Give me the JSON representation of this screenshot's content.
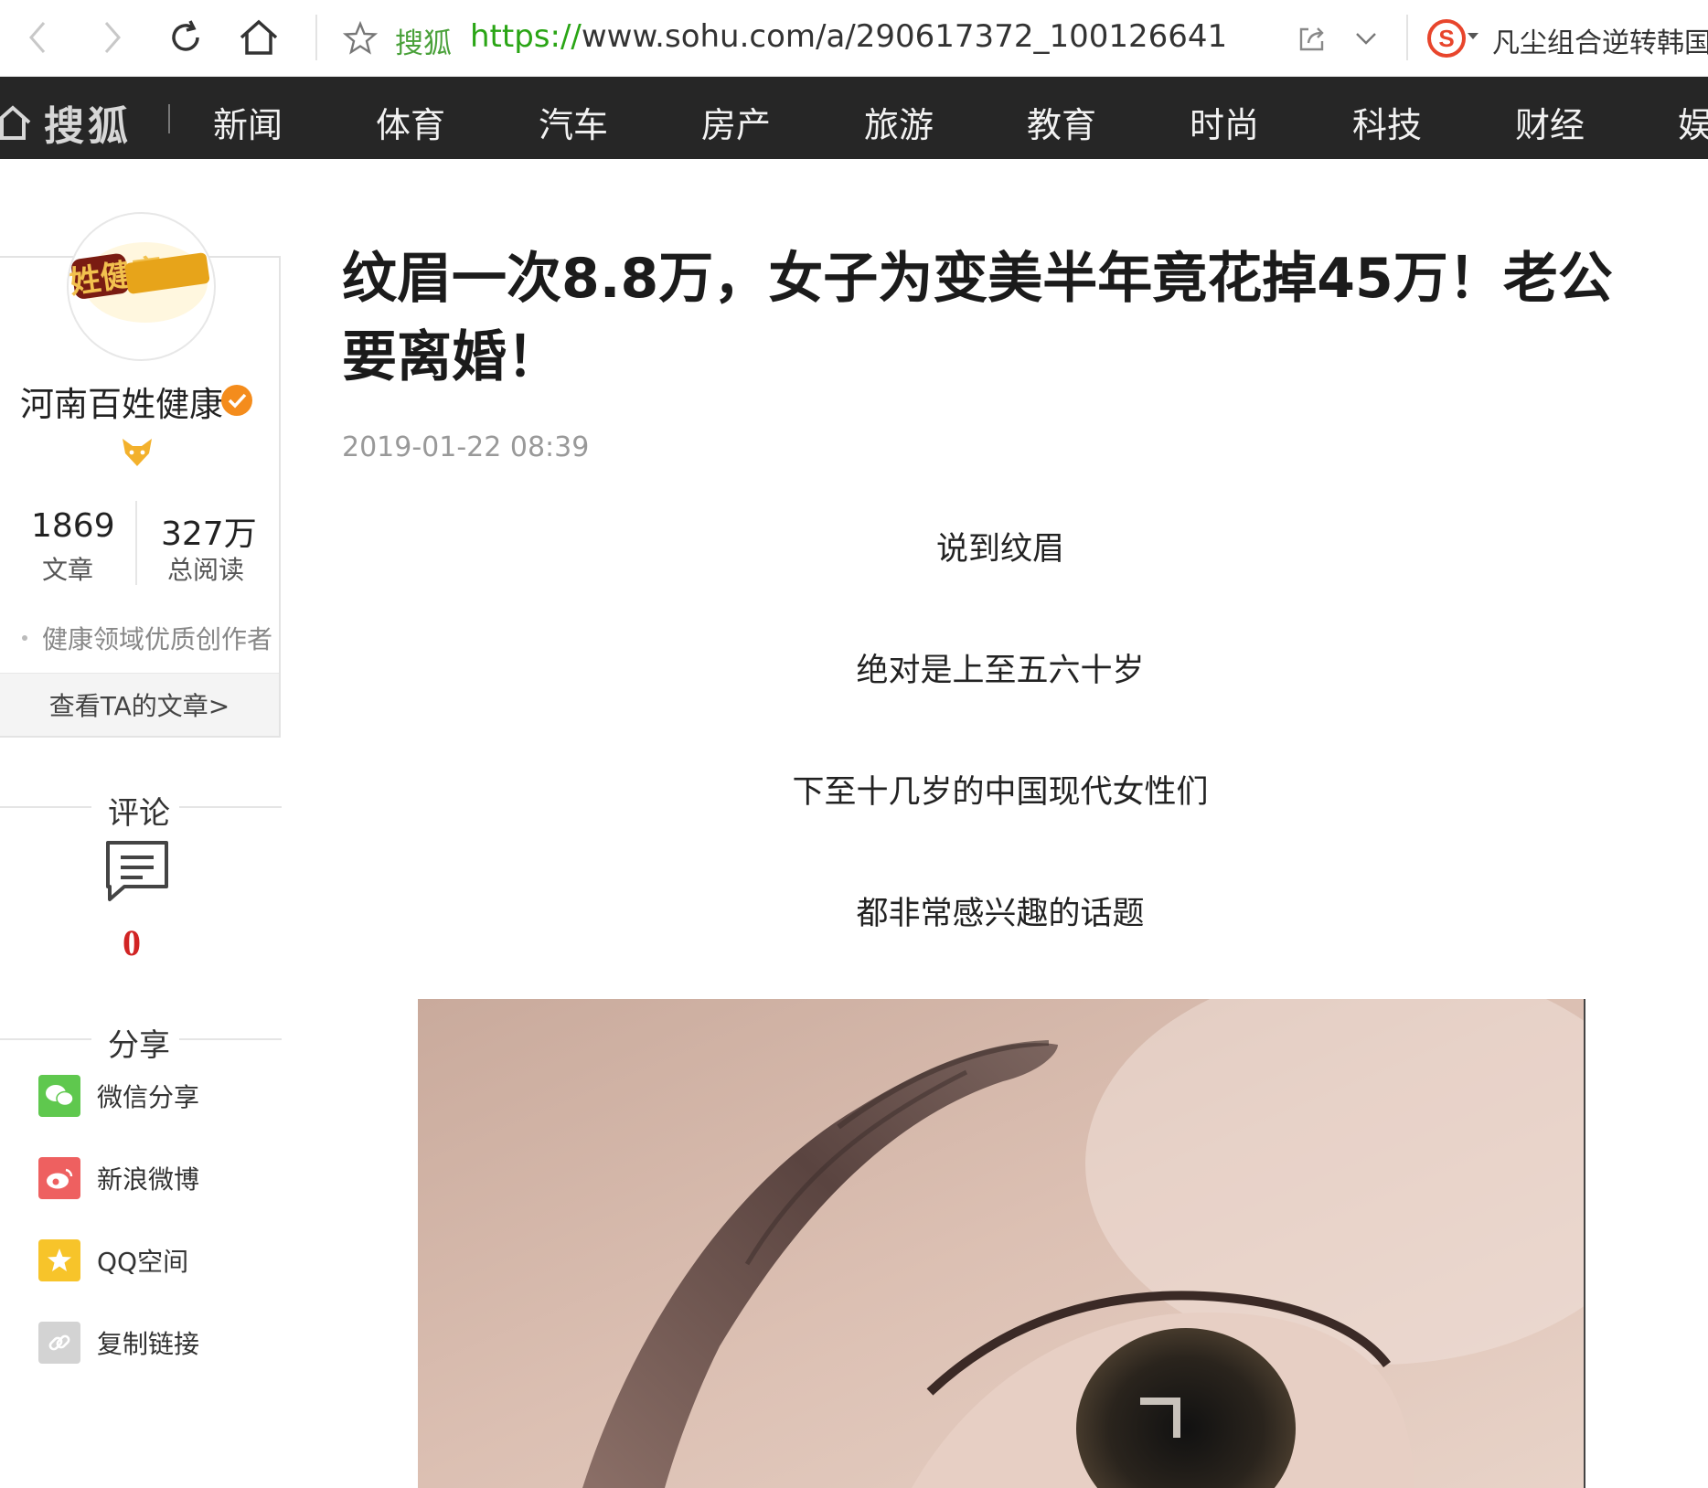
{
  "browser": {
    "site_name": "搜狐",
    "url_scheme": "https://",
    "url_rest": "www.sohu.com/a/290617372_100126641",
    "search_suggestion": "凡尘组合逆转韩国",
    "icons": [
      "back-icon",
      "forward-icon",
      "reload-icon",
      "home-icon",
      "star-icon",
      "share-page-icon",
      "dropdown-icon",
      "sogou-search-icon"
    ]
  },
  "channel_nav": {
    "logo_text": "搜狐",
    "items": [
      "新闻",
      "体育",
      "汽车",
      "房产",
      "旅游",
      "教育",
      "时尚",
      "科技",
      "财经",
      "娱"
    ]
  },
  "author": {
    "avatar_text": "百姓健康",
    "name": "河南百姓健康",
    "articles_count": "1869",
    "articles_label": "文章",
    "reads_count": "327万",
    "reads_label": "总阅读",
    "creator_tag": "健康领域优质创作者",
    "view_articles": "查看TA的文章>"
  },
  "comments": {
    "heading": "评论",
    "count": "0"
  },
  "share": {
    "heading": "分享",
    "items": [
      "微信分享",
      "新浪微博",
      "QQ空间",
      "复制链接"
    ]
  },
  "article": {
    "title": "纹眉一次8.8万，女子为变美半年竟花掉45万！老公要离婚！",
    "time": "2019-01-22 08:39",
    "paragraphs": [
      "说到纹眉",
      "绝对是上至五六十岁",
      "下至十几岁的中国现代女性们",
      "都非常感兴趣的话题"
    ]
  },
  "colors": {
    "nav_bg": "#262626",
    "url_green": "#2aa515",
    "comment_red": "#d12424",
    "wechat": "#5fc84e",
    "weibo": "#ee6060",
    "qzone": "#f7c42a",
    "link": "#d3d3d3"
  }
}
